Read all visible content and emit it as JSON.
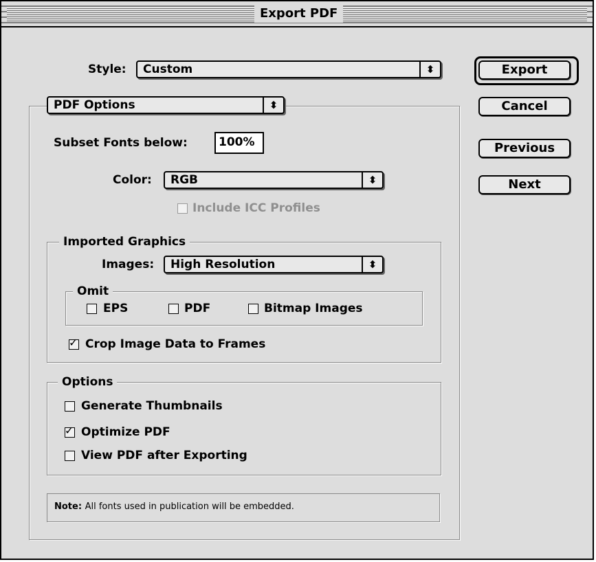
{
  "window": {
    "title": "Export PDF"
  },
  "buttons": {
    "export": "Export",
    "cancel": "Cancel",
    "previous": "Previous",
    "next": "Next"
  },
  "style_row": {
    "label": "Style:",
    "value": "Custom",
    "arrow": "⬍"
  },
  "section_popup": {
    "value": "PDF Options",
    "arrow": "⬍"
  },
  "subset_fonts": {
    "label": "Subset Fonts below:",
    "value": "100%"
  },
  "color_row": {
    "label": "Color:",
    "value": "RGB",
    "arrow": "⬍"
  },
  "icc": {
    "label": "Include ICC Profiles",
    "checked": false,
    "enabled": false
  },
  "imported_graphics": {
    "legend": "Imported Graphics",
    "images_label": "Images:",
    "images_value": "High Resolution",
    "arrow": "⬍",
    "omit": {
      "legend": "Omit",
      "eps": {
        "label": "EPS",
        "checked": false
      },
      "pdf": {
        "label": "PDF",
        "checked": false
      },
      "bitmap": {
        "label": "Bitmap Images",
        "checked": false
      }
    },
    "crop": {
      "label": "Crop Image Data to Frames",
      "checked": true
    }
  },
  "options": {
    "legend": "Options",
    "thumbnails": {
      "label": "Generate Thumbnails",
      "checked": false
    },
    "optimize": {
      "label": "Optimize PDF",
      "checked": true
    },
    "view_after": {
      "label": "View PDF after Exporting",
      "checked": false
    }
  },
  "note": {
    "label": "Note:",
    "text": "All fonts used in publication will be embedded."
  },
  "check_glyph": "✓"
}
